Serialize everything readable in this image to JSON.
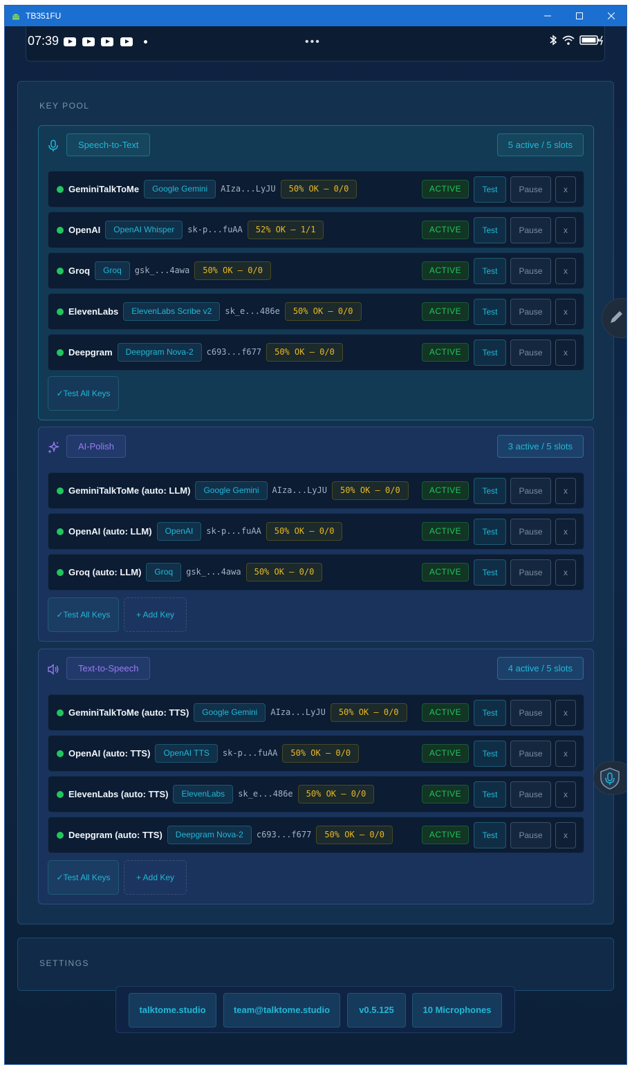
{
  "window": {
    "title": "TB351FU"
  },
  "statusbar": {
    "clock": "07:39"
  },
  "key_pool": {
    "title": "KEY POOL",
    "sections": [
      {
        "label": "Speech-to-Text",
        "slots": "5 active / 5 slots",
        "rows": [
          {
            "name": "GeminiTalkToMe",
            "provider": "Google Gemini",
            "key": "AIza...LyJU",
            "health": "50% OK – 0/0",
            "state": "ACTIVE"
          },
          {
            "name": "OpenAI",
            "provider": "OpenAI Whisper",
            "key": "sk-p...fuAA",
            "health": "52% OK – 1/1",
            "state": "ACTIVE"
          },
          {
            "name": "Groq",
            "provider": "Groq",
            "key": "gsk_...4awa",
            "health": "50% OK – 0/0",
            "state": "ACTIVE"
          },
          {
            "name": "ElevenLabs",
            "provider": "ElevenLabs Scribe v2",
            "key": "sk_e...486e",
            "health": "50% OK – 0/0",
            "state": "ACTIVE"
          },
          {
            "name": "Deepgram",
            "provider": "Deepgram Nova-2",
            "key": "c693...f677",
            "health": "50% OK – 0/0",
            "state": "ACTIVE"
          }
        ],
        "test_all": "✓Test All Keys"
      },
      {
        "label": "AI-Polish",
        "slots": "3 active / 5 slots",
        "rows": [
          {
            "name": "GeminiTalkToMe (auto: LLM)",
            "provider": "Google Gemini",
            "key": "AIza...LyJU",
            "health": "50% OK – 0/0",
            "state": "ACTIVE"
          },
          {
            "name": "OpenAI (auto: LLM)",
            "provider": "OpenAI",
            "key": "sk-p...fuAA",
            "health": "50% OK – 0/0",
            "state": "ACTIVE"
          },
          {
            "name": "Groq (auto: LLM)",
            "provider": "Groq",
            "key": "gsk_...4awa",
            "health": "50% OK – 0/0",
            "state": "ACTIVE"
          }
        ],
        "test_all": "✓Test All Keys",
        "add_key": "+ Add Key"
      },
      {
        "label": "Text-to-Speech",
        "slots": "4 active / 5 slots",
        "rows": [
          {
            "name": "GeminiTalkToMe (auto: TTS)",
            "provider": "Google Gemini",
            "key": "AIza...LyJU",
            "health": "50% OK – 0/0",
            "state": "ACTIVE"
          },
          {
            "name": "OpenAI (auto: TTS)",
            "provider": "OpenAI TTS",
            "key": "sk-p...fuAA",
            "health": "50% OK – 0/0",
            "state": "ACTIVE"
          },
          {
            "name": "ElevenLabs (auto: TTS)",
            "provider": "ElevenLabs",
            "key": "sk_e...486e",
            "health": "50% OK – 0/0",
            "state": "ACTIVE"
          },
          {
            "name": "Deepgram (auto: TTS)",
            "provider": "Deepgram Nova-2",
            "key": "c693...f677",
            "health": "50% OK – 0/0",
            "state": "ACTIVE"
          }
        ],
        "test_all": "✓Test All Keys",
        "add_key": "+ Add Key"
      }
    ],
    "row_buttons": {
      "test": "Test",
      "pause": "Pause",
      "remove": "x"
    }
  },
  "settings": {
    "title": "SETTINGS"
  },
  "footer": {
    "links": [
      "talktome.studio",
      "team@talktome.studio",
      "v0.5.125",
      "10 Microphones"
    ]
  },
  "colors": {
    "accent": "#22b8d6",
    "active": "#22c55e",
    "health": "#e9b825",
    "polish": "#9a7bf0"
  }
}
